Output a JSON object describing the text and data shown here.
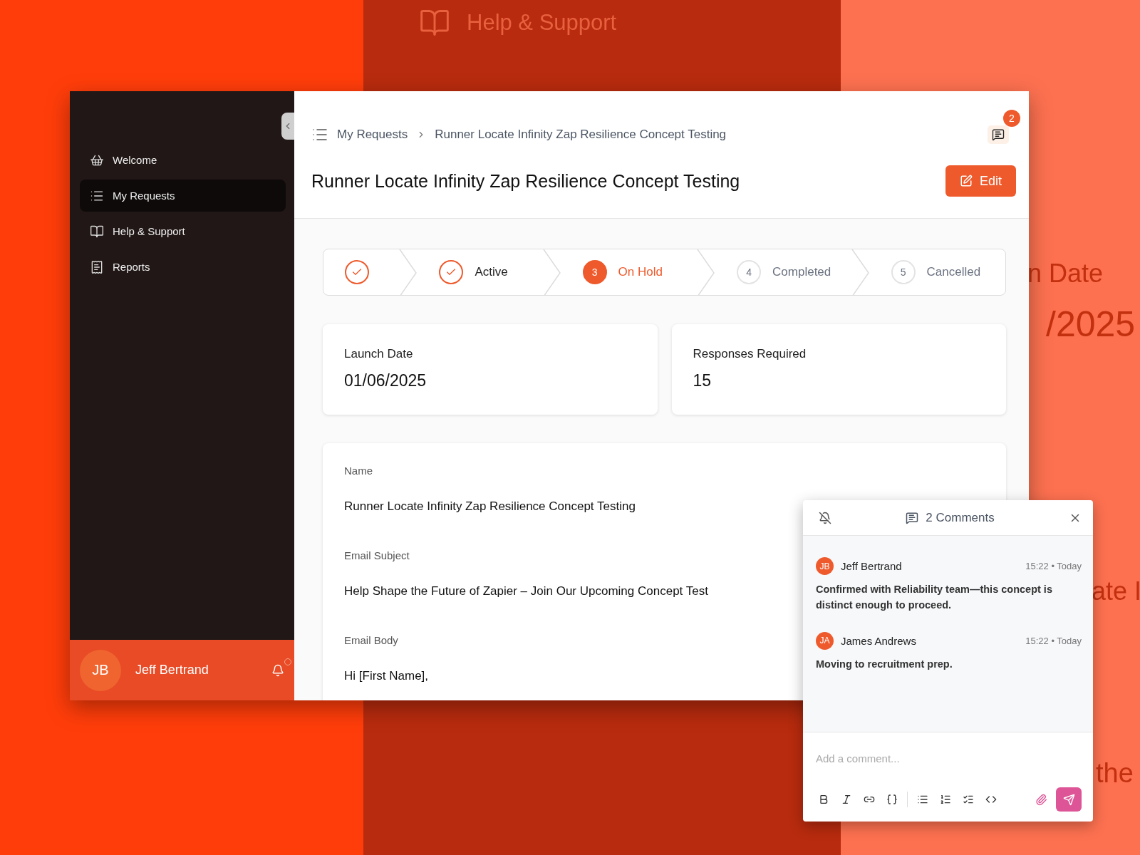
{
  "backdrop": {
    "sidebar_item": "Help & Support",
    "texts": [
      "n Date",
      "/2025",
      "ate I",
      "the"
    ]
  },
  "sidebar": {
    "items": [
      {
        "label": "Welcome",
        "selected": false
      },
      {
        "label": "My Requests",
        "selected": true
      },
      {
        "label": "Help & Support",
        "selected": false
      },
      {
        "label": "Reports",
        "selected": false
      }
    ],
    "user": {
      "initials": "JB",
      "name": "Jeff Bertrand"
    }
  },
  "header": {
    "breadcrumb": [
      "My Requests",
      "Runner Locate Infinity Zap Resilience Concept Testing"
    ],
    "comment_count": "2",
    "title": "Runner Locate Infinity Zap Resilience Concept Testing",
    "edit_button": "Edit"
  },
  "stepper": [
    {
      "kind": "done"
    },
    {
      "kind": "done",
      "label": "Active"
    },
    {
      "kind": "current",
      "number": "3",
      "label": "On Hold"
    },
    {
      "kind": "upcoming",
      "number": "4",
      "label": "Completed"
    },
    {
      "kind": "upcoming",
      "number": "5",
      "label": "Cancelled"
    }
  ],
  "stats": [
    {
      "label": "Launch Date",
      "value": "01/06/2025"
    },
    {
      "label": "Responses Required",
      "value": "15"
    }
  ],
  "fields": [
    {
      "label": "Name",
      "value": "Runner Locate Infinity Zap Resilience Concept Testing"
    },
    {
      "label": "Email Subject",
      "value": "Help Shape the Future of Zapier – Join Our Upcoming Concept Test"
    },
    {
      "label": "Email Body",
      "value": "Hi [First Name],"
    }
  ],
  "comments_panel": {
    "title": "2 Comments",
    "comments": [
      {
        "initials": "JB",
        "author": "Jeff Bertrand",
        "time": "15:22 • Today",
        "text": "Confirmed with Reliability team—this concept is distinct enough to proceed."
      },
      {
        "initials": "JA",
        "author": "James Andrews",
        "time": "15:22 • Today",
        "text": "Moving to recruitment prep."
      }
    ],
    "placeholder": "Add a comment..."
  }
}
